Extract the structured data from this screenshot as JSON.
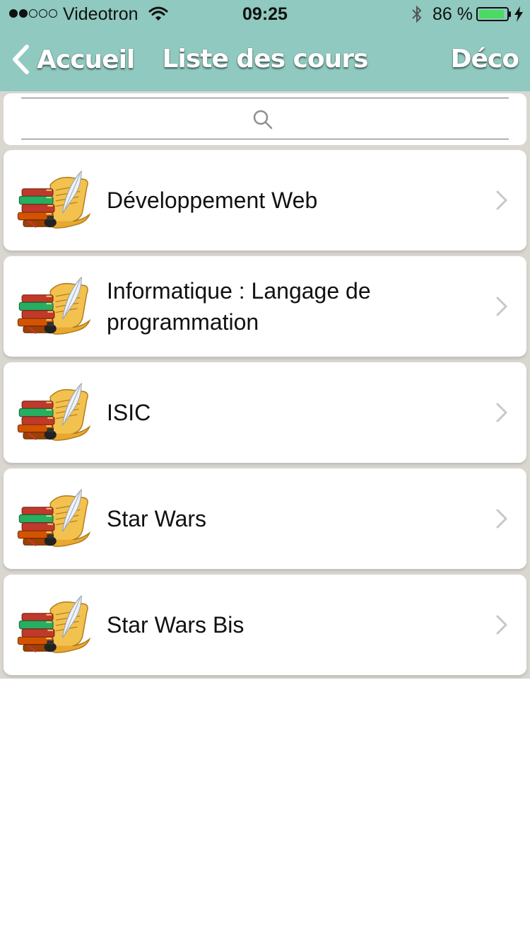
{
  "status_bar": {
    "carrier": "Videotron",
    "time": "09:25",
    "battery": "86 %",
    "signal_bars_on": 2,
    "signal_bars_total": 5
  },
  "nav": {
    "back_label": "Accueil",
    "title": "Liste des cours",
    "right_label": "Déco"
  },
  "search": {
    "placeholder": "",
    "value": ""
  },
  "courses": [
    {
      "label": "Développement Web",
      "icon": "books-scroll-quill-icon"
    },
    {
      "label": "Informatique : Langage de programmation",
      "icon": "books-scroll-quill-icon"
    },
    {
      "label": "ISIC",
      "icon": "books-scroll-quill-icon"
    },
    {
      "label": "Star Wars",
      "icon": "books-scroll-quill-icon"
    },
    {
      "label": "Star Wars Bis",
      "icon": "books-scroll-quill-icon"
    }
  ],
  "colors": {
    "header": "#8fc9bf",
    "list_background": "#d9d7d0",
    "card": "#ffffff",
    "battery_fill": "#4cd964",
    "chevron": "#c7c7cc"
  }
}
